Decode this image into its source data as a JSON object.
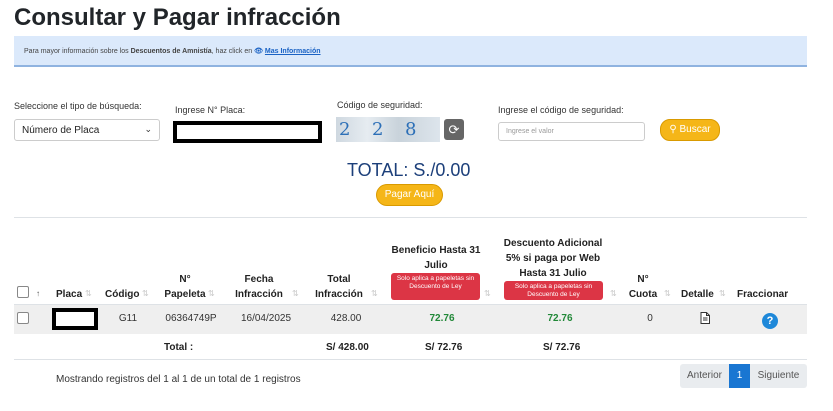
{
  "page": {
    "title": "Consultar y Pagar infracción"
  },
  "banner": {
    "text_before": "Para mayor información sobre los ",
    "bold": "Descuentos de Amnistía",
    "text_after": ", haz click en ",
    "link_icon": "👁",
    "link": "Mas Información"
  },
  "search": {
    "type_label": "Seleccione el tipo de búsqueda:",
    "type_value": "Número de Placa",
    "plate_label": "Ingrese N° Placa:",
    "captcha_label": "Código de seguridad:",
    "captcha_chars": [
      "2",
      "2",
      "8"
    ],
    "code_label": "Ingrese el código de seguridad:",
    "code_placeholder": "Ingrese el valor",
    "search_button": "Buscar"
  },
  "total": {
    "text": "TOTAL: S./0.00",
    "pay_button": "Pagar Aquí"
  },
  "table": {
    "headers": {
      "placa": "Placa",
      "codigo": "Código",
      "papeleta": "N° Papeleta",
      "fecha": "Fecha Infracción",
      "total": "Total Infracción",
      "beneficio": "Beneficio Hasta 31 Julio",
      "descuento": "Descuento Adicional 5% si paga por Web Hasta 31 Julio",
      "cuota": "N° Cuota",
      "detalle": "Detalle",
      "fraccionar": "Fraccionar"
    },
    "badge": "Solo aplica a papeletas sin Descuento de Ley",
    "row": {
      "codigo": "G11",
      "papeleta": "06364749P",
      "fecha": "16/04/2025",
      "total": "428.00",
      "beneficio": "72.76",
      "descuento": "72.76",
      "cuota": "0"
    },
    "footer": {
      "label": "Total :",
      "total": "S/ 428.00",
      "beneficio": "S/ 72.76",
      "descuento": "S/ 72.76"
    }
  },
  "pagination": {
    "info": "Mostrando registros del 1 al 1 de un total de 1 registros",
    "prev": "Anterior",
    "current": "1",
    "next": "Siguiente"
  },
  "colors": {
    "accent": "#f5b618",
    "link": "#1a62c4",
    "badge": "#dc3545",
    "pager_active": "#1976d2"
  }
}
